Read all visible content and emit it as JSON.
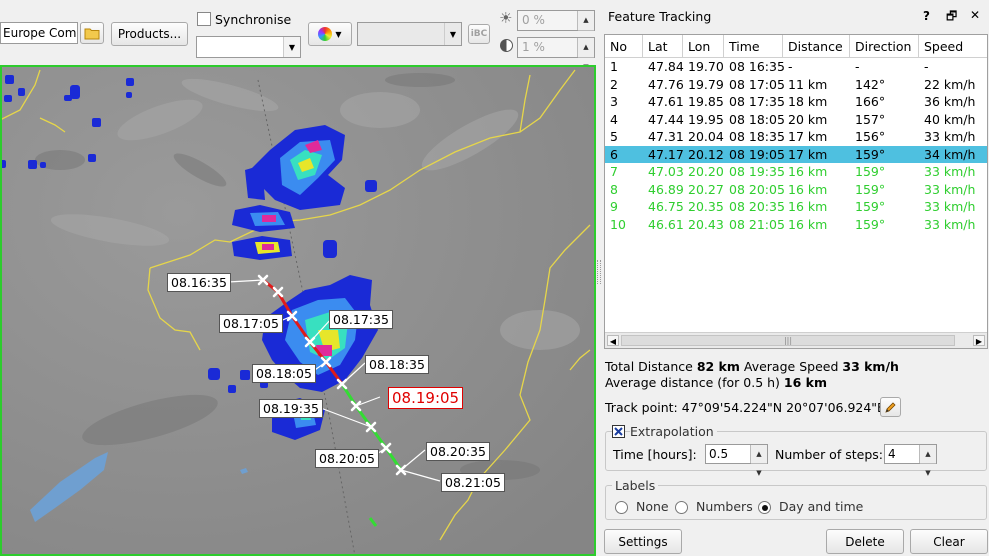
{
  "toolbar": {
    "product_combo_value": "Europe Compo",
    "products_button": "Products...",
    "synchronise_label": "Synchronise",
    "opacity_value": "0 %",
    "gamma_value": "1 %",
    "ibc_label": "iBC"
  },
  "panel": {
    "title": "Feature Tracking",
    "help": "?",
    "float": "🗗",
    "close": "✕"
  },
  "table": {
    "headers": [
      "No",
      "Lat",
      "Lon",
      "Time",
      "Distance",
      "Direction",
      "Speed"
    ],
    "rows": [
      [
        "1",
        "47.84",
        "19.70",
        "08 16:35",
        "-",
        "-",
        "-"
      ],
      [
        "2",
        "47.76",
        "19.79",
        "08 17:05",
        "11 km",
        "142°",
        "22 km/h"
      ],
      [
        "3",
        "47.61",
        "19.85",
        "08 17:35",
        "18 km",
        "166°",
        "36 km/h"
      ],
      [
        "4",
        "47.44",
        "19.95",
        "08 18:05",
        "20 km",
        "157°",
        "40 km/h"
      ],
      [
        "5",
        "47.31",
        "20.04",
        "08 18:35",
        "17 km",
        "156°",
        "33 km/h"
      ],
      [
        "6",
        "47.17",
        "20.12",
        "08 19:05",
        "17 km",
        "159°",
        "34 km/h"
      ],
      [
        "7",
        "47.03",
        "20.20",
        "08 19:35",
        "16 km",
        "159°",
        "33 km/h"
      ],
      [
        "8",
        "46.89",
        "20.27",
        "08 20:05",
        "16 km",
        "159°",
        "33 km/h"
      ],
      [
        "9",
        "46.75",
        "20.35",
        "08 20:35",
        "16 km",
        "159°",
        "33 km/h"
      ],
      [
        "10",
        "46.61",
        "20.43",
        "08 21:05",
        "16 km",
        "159°",
        "33 km/h"
      ]
    ],
    "selected_row": 5,
    "extrapolated_from": 6
  },
  "summary": {
    "total_distance_label": "Total Distance",
    "total_distance_value": "82 km",
    "avg_speed_label": "Average Speed",
    "avg_speed_value": "33 km/h",
    "avg_distance_label": "Average distance (for 0.5 h)",
    "avg_distance_value": "16 km",
    "track_point_label": "Track point:",
    "track_point_value": "47°09'54.224\"N 20°07'06.924\"E"
  },
  "extrapolation": {
    "label": "Extrapolation",
    "checked": true,
    "time_label": "Time [hours]:",
    "time_value": "0.5",
    "steps_label": "Number of steps:",
    "steps_value": "4"
  },
  "labels_group": {
    "title": "Labels",
    "options": [
      "None",
      "Numbers",
      "Day and time"
    ],
    "selected": "Day and time"
  },
  "buttons": {
    "settings": "Settings",
    "delete": "Delete",
    "clear": "Clear"
  },
  "map": {
    "track_labels": [
      "08.16:35",
      "08.17:05",
      "08.17:35",
      "08.18:05",
      "08.18:35",
      "08.19:05",
      "08.19:35",
      "08.20:05",
      "08.20:35",
      "08.21:05"
    ],
    "current_label": "08.19:05"
  },
  "colors": {
    "past_track": "#e01a1a",
    "future_track": "#33dd33",
    "selected_row": "#4ec0e0",
    "border_lines": "#e6d64a",
    "map_frame": "#2dcc2d"
  }
}
